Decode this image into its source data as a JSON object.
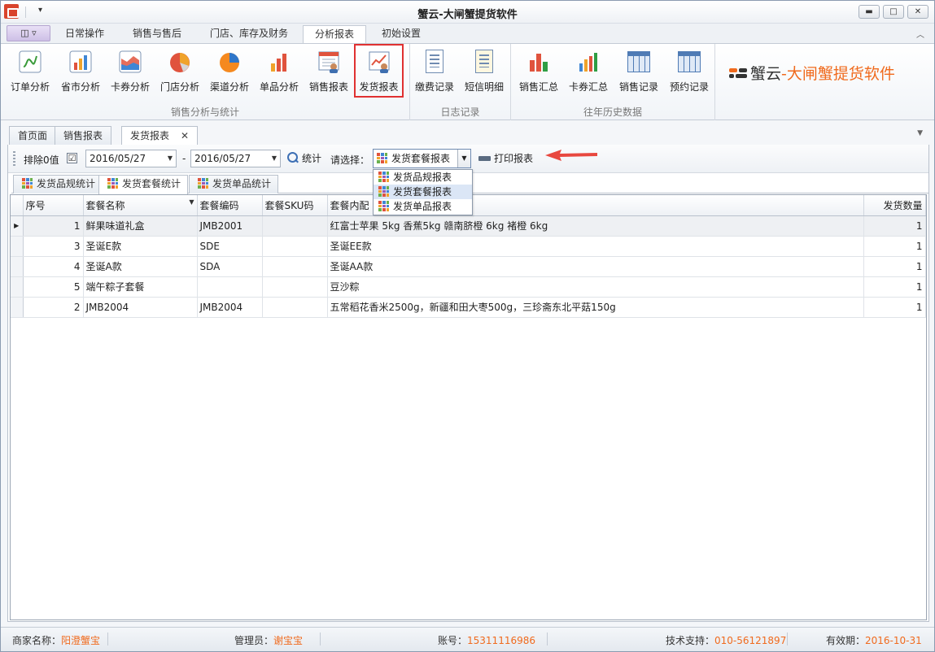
{
  "window": {
    "title": "蟹云-大闸蟹提货软件",
    "controls": {
      "minimize": "▬",
      "maximize": "□",
      "close": "✕"
    }
  },
  "ribbon_tabs": [
    "日常操作",
    "销售与售后",
    "门店、库存及财务",
    "分析报表",
    "初始设置"
  ],
  "active_ribbon_tab": "分析报表",
  "ribbon_groups": [
    {
      "label": "销售分析与统计",
      "buttons": [
        "订单分析",
        "省市分析",
        "卡券分析",
        "门店分析",
        "渠道分析",
        "单品分析",
        "销售报表",
        "发货报表"
      ]
    },
    {
      "label": "日志记录",
      "buttons": [
        "缴费记录",
        "短信明细"
      ]
    },
    {
      "label": "往年历史数据",
      "buttons": [
        "销售汇总",
        "卡券汇总",
        "销售记录",
        "预约记录"
      ]
    }
  ],
  "highlighted_button": "发货报表",
  "brand": {
    "part1": "蟹云",
    "part2": "-大闸蟹提货软件"
  },
  "doc_tabs": [
    "首页面",
    "销售报表",
    "发货报表"
  ],
  "active_doc_tab": "发货报表",
  "toolbar": {
    "exclude_zero_label": "排除0值",
    "exclude_zero_checked": "☑",
    "date_from": "2016/05/27",
    "date_sep": "-",
    "date_to": "2016/05/27",
    "stat_label": "统计",
    "select_label": "请选择：",
    "selected_report": "发货套餐报表",
    "print_label": "打印报表"
  },
  "report_options": [
    "发货品规报表",
    "发货套餐报表",
    "发货单品报表"
  ],
  "sub_tabs": [
    "发货品规统计",
    "发货套餐统计",
    "发货单品统计"
  ],
  "active_sub_tab": "发货套餐统计",
  "grid": {
    "columns": [
      "序号",
      "套餐名称",
      "套餐编码",
      "套餐SKU码",
      "套餐内配",
      "发货数量"
    ],
    "rows": [
      {
        "seq": "1",
        "name": "鲜果味道礼盒",
        "code": "JMB2001",
        "sku": "",
        "content": "红富士苹果 5kg  香蕉5kg  赣南脐橙 6kg 褚橙 6kg",
        "qty": "1"
      },
      {
        "seq": "3",
        "name": "圣诞E款",
        "code": "SDE",
        "sku": "",
        "content": "圣诞EE款",
        "qty": "1"
      },
      {
        "seq": "4",
        "name": "圣诞A款",
        "code": "SDA",
        "sku": "",
        "content": "圣诞AA款",
        "qty": "1"
      },
      {
        "seq": "5",
        "name": "端午粽子套餐",
        "code": "",
        "sku": "",
        "content": "豆沙粽",
        "qty": "1"
      },
      {
        "seq": "2",
        "name": "JMB2004",
        "code": "JMB2004",
        "sku": "",
        "content": "五常稻花香米2500g，新疆和田大枣500g，三珍斋东北平菇150g",
        "qty": "1"
      }
    ]
  },
  "status": {
    "merchant_label": "商家名称：",
    "merchant_value": "阳澄蟹宝",
    "admin_label": "管理员：",
    "admin_value": "谢宝宝",
    "account_label": "账号：",
    "account_value": "15311116986",
    "support_label": "技术支持：",
    "support_value": "010-56121897",
    "expiry_label": "有效期：",
    "expiry_value": "2016-10-31"
  },
  "colors": {
    "accent": "#f06a1d",
    "highlight": "#e03131",
    "selection": "#dbe6f6"
  }
}
